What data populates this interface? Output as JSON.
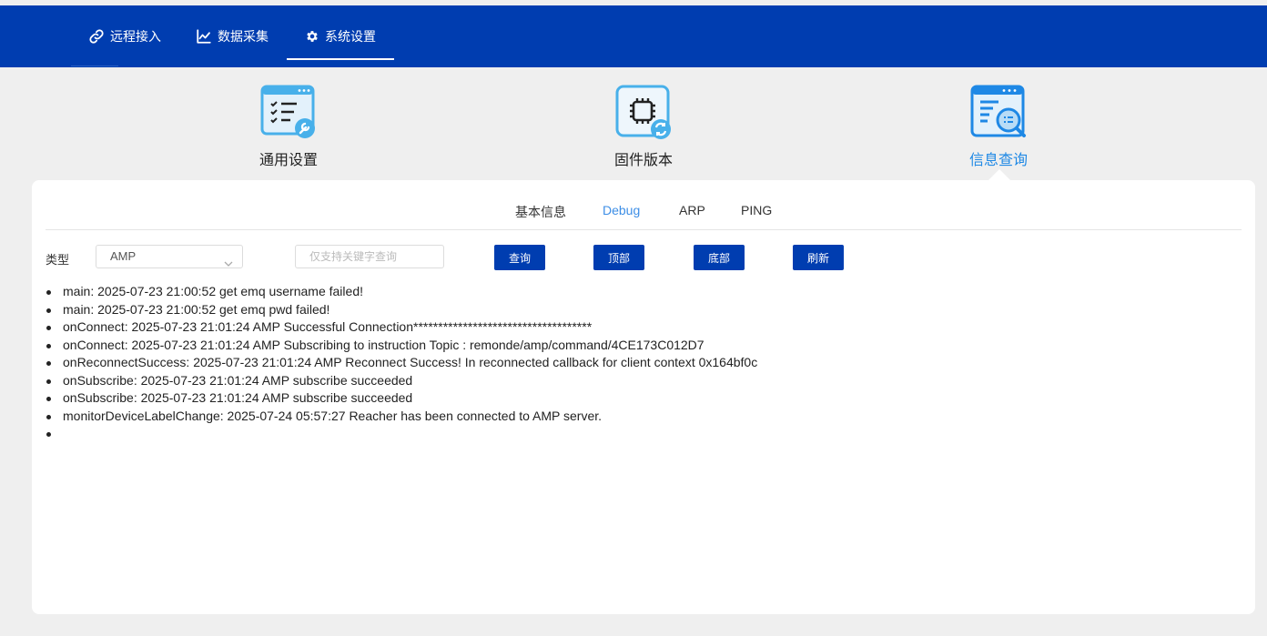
{
  "nav": {
    "items": [
      {
        "label": "远程接入",
        "icon": "link-icon"
      },
      {
        "label": "数据采集",
        "icon": "line-chart-icon"
      },
      {
        "label": "系统设置",
        "icon": "gear-icon"
      }
    ],
    "active_index": 2
  },
  "categories": [
    {
      "label": "通用设置",
      "icon": "general-settings-icon"
    },
    {
      "label": "固件版本",
      "icon": "firmware-chip-icon"
    },
    {
      "label": "信息查询",
      "icon": "info-query-icon"
    }
  ],
  "subtabs": {
    "items": [
      "基本信息",
      "Debug",
      "ARP",
      "PING"
    ],
    "active": "Debug"
  },
  "filter": {
    "type_label": "类型",
    "type_value": "AMP",
    "search_placeholder": "仅支持关键字查询",
    "search_value": ""
  },
  "buttons": {
    "query": "查询",
    "top": "顶部",
    "bottom": "底部",
    "refresh": "刷新"
  },
  "log_lines": [
    "main: 2025-07-23 21:00:52 get emq username failed!",
    "main: 2025-07-23 21:00:52 get emq pwd failed!",
    "onConnect: 2025-07-23 21:01:24 AMP Successful Connection************************************",
    "onConnect: 2025-07-23 21:01:24 AMP Subscribing to instruction Topic : remonde/amp/command/4CE173C012D7",
    "onReconnectSuccess: 2025-07-23 21:01:24 AMP Reconnect Success! In reconnected callback for client context 0x164bf0c",
    "onSubscribe: 2025-07-23 21:01:24 AMP subscribe succeeded",
    "onSubscribe: 2025-07-23 21:01:24 AMP subscribe succeeded",
    "monitorDeviceLabelChange: 2025-07-24 05:57:27 Reacher has been connected to AMP server.",
    ""
  ],
  "colors": {
    "nav_bg": "#003db0",
    "accent": "#1e88e5",
    "button_bg": "#003db0",
    "page_bg": "#efefef"
  }
}
